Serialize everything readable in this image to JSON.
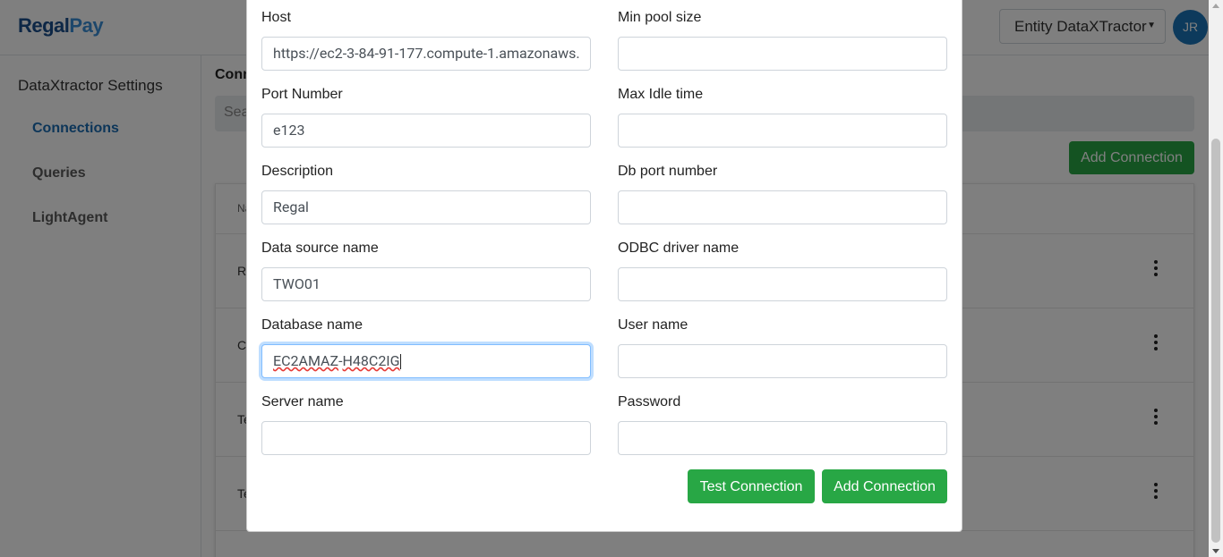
{
  "header": {
    "logo_regal": "Regal",
    "logo_pay": "Pay",
    "entity_select_value": "Entity DataXTractor",
    "avatar_initials": "JR"
  },
  "sidebar": {
    "title": "DataXtractor Settings",
    "items": [
      {
        "label": "Connections"
      },
      {
        "label": "Queries"
      },
      {
        "label": "LightAgent"
      }
    ]
  },
  "main": {
    "heading_partial": "Conn",
    "search_placeholder_partial": "Sea",
    "add_connection_label": "Add Connection",
    "table_header_partial": "Na",
    "rows": [
      {
        "name_partial": "Re"
      },
      {
        "name_partial": "Cl"
      },
      {
        "name_partial": "Te"
      },
      {
        "name_partial": "Te"
      }
    ]
  },
  "modal": {
    "host_label": "Host",
    "host_value": "https://ec2-3-84-91-177.compute-1.amazonaws.",
    "port_label": "Port Number",
    "port_value": "e123",
    "description_label": "Description",
    "description_value": "Regal",
    "dsn_label": "Data source name",
    "dsn_value": "TWO01",
    "dbname_label": "Database name",
    "dbname_value_a": "EC2AMAZ",
    "dbname_value_b": "-",
    "dbname_value_c": "H48C2IG",
    "server_label": "Server name",
    "server_value": "",
    "minpool_label": "Min pool size",
    "minpool_value": "",
    "maxidle_label": "Max Idle time",
    "maxidle_value": "",
    "dbport_label": "Db port number",
    "dbport_value": "",
    "odbc_label": "ODBC driver name",
    "odbc_value": "",
    "username_label": "User name",
    "username_value": "",
    "password_label": "Password",
    "password_value": "",
    "test_button": "Test Connection",
    "add_button": "Add Connection"
  },
  "colors": {
    "accent_green": "#28a745",
    "brand_blue": "#1b6cb3",
    "focus_border": "#80bdff"
  }
}
